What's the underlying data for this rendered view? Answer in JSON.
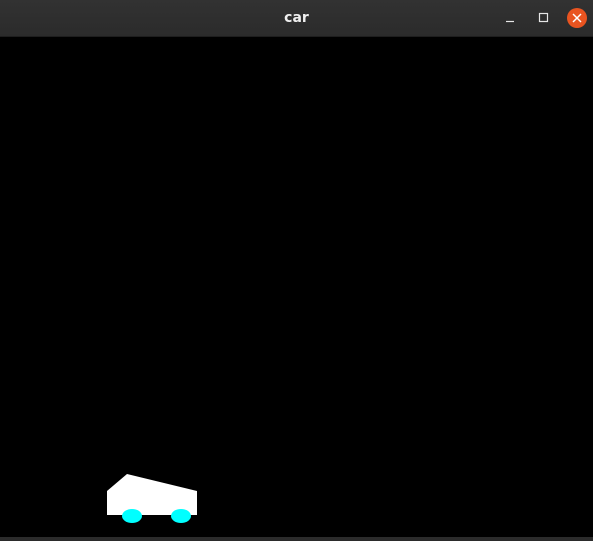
{
  "window": {
    "title": "car"
  },
  "controls": {
    "minimize_icon": "minimize-icon",
    "maximize_icon": "maximize-icon",
    "close_icon": "close-icon",
    "close_color": "#e95420"
  },
  "scene": {
    "background_color": "#000000",
    "car_body_color": "#ffffff",
    "wheel_color": "#00ffff"
  }
}
